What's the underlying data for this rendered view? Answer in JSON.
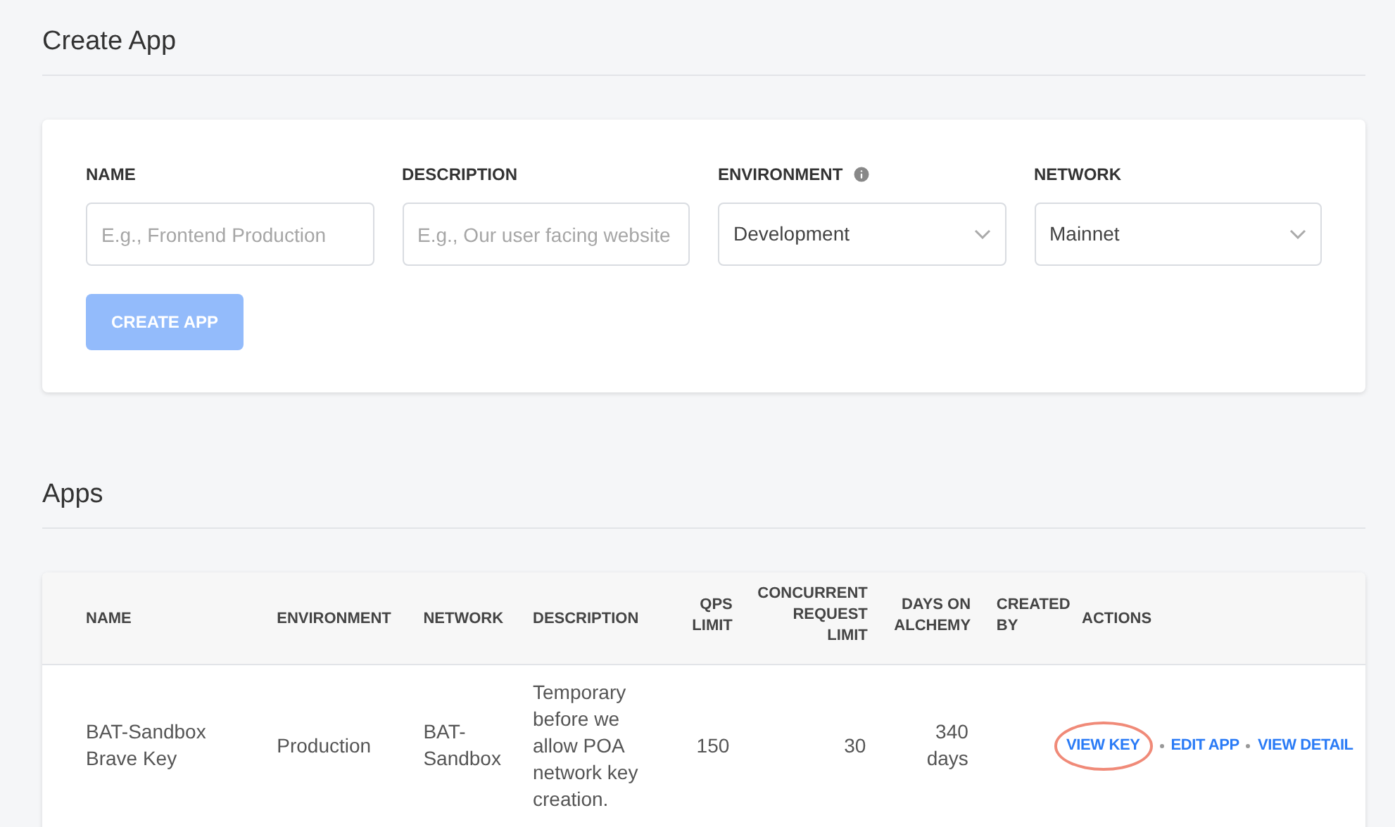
{
  "create_section": {
    "title": "Create App"
  },
  "create_form": {
    "fields": [
      {
        "kind": "text",
        "label": "NAME",
        "placeholder": "E.g., Frontend Production"
      },
      {
        "kind": "text",
        "label": "DESCRIPTION",
        "placeholder": "E.g., Our user facing website"
      },
      {
        "kind": "select",
        "label": "ENVIRONMENT",
        "value": "Development",
        "info": true
      },
      {
        "kind": "select",
        "label": "NETWORK",
        "value": "Mainnet"
      }
    ],
    "submit": {
      "label": "CREATE APP",
      "disabled": true
    }
  },
  "apps_section": {
    "title": "Apps"
  },
  "table": {
    "columns": [
      {
        "label": "NAME",
        "kind": "text"
      },
      {
        "label": "ENVIRONMENT",
        "kind": "text"
      },
      {
        "label": "NETWORK",
        "kind": "text"
      },
      {
        "label": "DESCRIPTION",
        "kind": "text"
      },
      {
        "label": "QPS LIMIT",
        "kind": "number"
      },
      {
        "label": "CONCURRENT REQUEST LIMIT",
        "kind": "number"
      },
      {
        "label": "DAYS ON ALCHEMY",
        "kind": "number"
      },
      {
        "label": "CREATED BY",
        "kind": "text"
      },
      {
        "label": "ACTIONS",
        "kind": "text"
      }
    ],
    "rows": [
      {
        "cells": [
          "BAT-Sandbox Brave Key",
          "Production",
          "BAT-Sandbox",
          "Temporary before we allow POA network key creation.",
          "150",
          "30",
          "340 days"
        ],
        "actions": [
          {
            "label": "VIEW KEY",
            "circled": true
          },
          {
            "label": "EDIT APP",
            "circled": false
          },
          {
            "label": "VIEW DETAIL",
            "circled": false
          }
        ]
      }
    ]
  }
}
